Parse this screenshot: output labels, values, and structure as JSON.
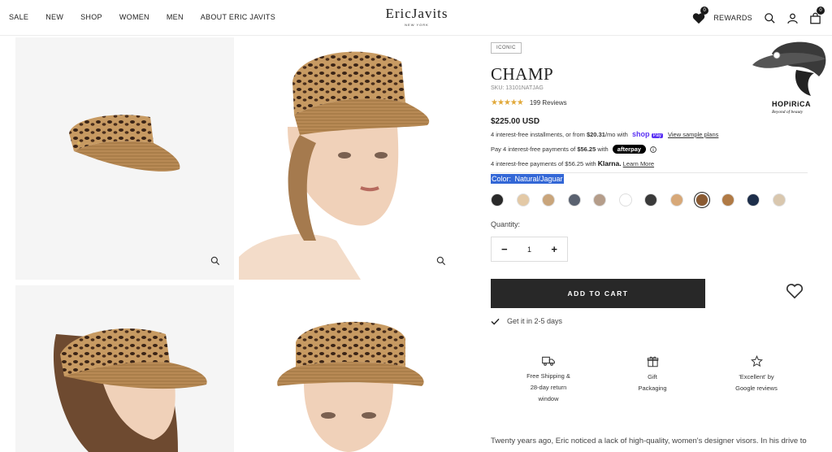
{
  "nav": {
    "items": [
      "SALE",
      "NEW",
      "SHOP",
      "WOMEN",
      "MEN",
      "ABOUT ERIC JAVITS"
    ]
  },
  "brand": {
    "name": "EricJavits",
    "sub": "NEW YORK"
  },
  "header": {
    "wishlist_count": "0",
    "rewards_label": "REWARDS",
    "cart_count": "0"
  },
  "watermark": {
    "name": "HOPiRiCA",
    "tagline": "Beyond of beauty"
  },
  "product": {
    "badge": "ICONIC",
    "title": "CHAMP",
    "sku": "SKU: 13101NATJAG",
    "rating_stars": 5,
    "reviews": "199 Reviews",
    "price": "$225.00 USD",
    "shoppay_text_pre": "4 interest-free installments, or from ",
    "shoppay_amount": "$20.31",
    "shoppay_text_post": "/mo with",
    "shoppay_brand": "shop",
    "shoppay_pay": "Pay",
    "shoppay_link": "View sample plans",
    "afterpay_pre": "Pay 4 interest-free payments of ",
    "afterpay_amount": "$56.25",
    "afterpay_with": " with",
    "afterpay_brand": "afterpay",
    "klarna_pre": "4 interest-free payments of $56.25 with ",
    "klarna_brand": "Klarna.",
    "klarna_link": "Learn More",
    "color_label": "Color: ",
    "color_value": "Natural/Jaguar",
    "swatch_colors": [
      "#2a2a2a",
      "#e3c9a6",
      "#c9a57b",
      "#5a6270",
      "#b59d8a",
      "#ffffff",
      "#3a3a3a",
      "#d7a878",
      "#8a5a32",
      "#b07a45",
      "#1d2e4a",
      "#d9c7ae"
    ],
    "quantity_label": "Quantity:",
    "quantity_value": "1",
    "add_to_cart": "ADD TO CART",
    "delivery": "Get it in 2-5 days",
    "features": [
      {
        "line1": "Free Shipping &",
        "line2": "28-day return",
        "line3": "window"
      },
      {
        "line1": "Gift",
        "line2": "Packaging",
        "line3": ""
      },
      {
        "line1": "'Excellent' by",
        "line2": "Google reviews",
        "line3": ""
      }
    ],
    "description": "Twenty years ago, Eric noticed a lack of high-quality, women's designer visors. In his drive to"
  }
}
